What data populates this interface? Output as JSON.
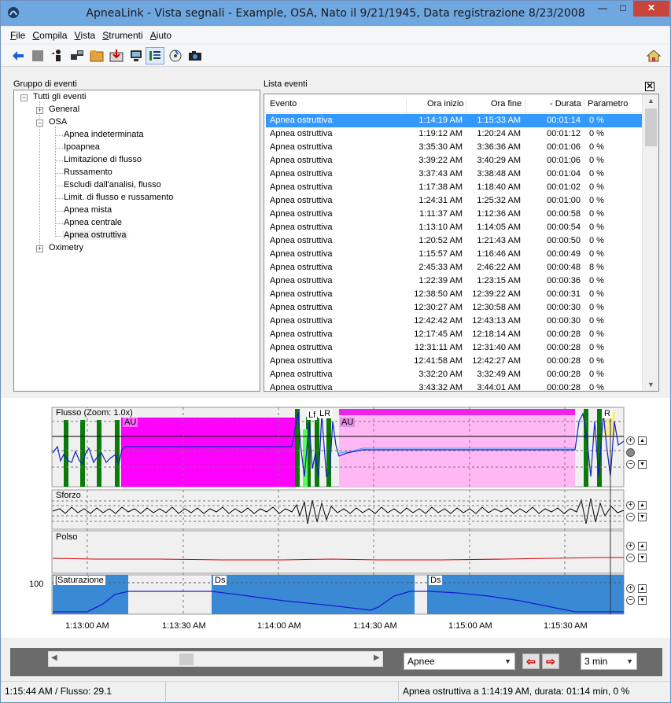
{
  "window": {
    "title": "ApneaLink - Vista segnali - Example, OSA, Nato il 9/21/1945, Data registrazione 8/23/2008"
  },
  "menu": [
    {
      "hotkey": "F",
      "rest": "ile"
    },
    {
      "hotkey": "C",
      "rest": "ompila"
    },
    {
      "hotkey": "V",
      "rest": "ista"
    },
    {
      "hotkey": "S",
      "rest": "trumenti"
    },
    {
      "hotkey": "A",
      "rest": "iuto"
    }
  ],
  "toolbar": {
    "icons": [
      "back-arrow-icon",
      "stop-icon",
      "person-icon",
      "computer-transfer-icon",
      "folder-icon",
      "import-icon",
      "monitor-icon",
      "signal-view-icon",
      "cd-icon",
      "camera-icon",
      "home-icon"
    ]
  },
  "tree": {
    "title": "Gruppo di eventi",
    "root": "Tutti gli eventi",
    "general": "General",
    "osa": "OSA",
    "osa_children": [
      "Apnea  indeterminata",
      "Ipoapnea",
      "Limitazione di flusso",
      "Russamento",
      "Escludi dall'analisi, flusso",
      "Limit. di flusso e russamento",
      "Apnea mista",
      "Apnea centrale",
      "Apnea ostruttiva"
    ],
    "oximetry": "Oximetry"
  },
  "event_list": {
    "title": "Lista eventi",
    "columns": [
      "Evento",
      "Ora inizio",
      "Ora fine",
      "- Durata",
      "Parametro"
    ],
    "rows": [
      [
        "Apnea ostruttiva",
        "1:14:19 AM",
        "1:15:33 AM",
        "00:01:14",
        "0 %"
      ],
      [
        "Apnea ostruttiva",
        "1:19:12 AM",
        "1:20:24 AM",
        "00:01:12",
        "0 %"
      ],
      [
        "Apnea ostruttiva",
        "3:35:30 AM",
        "3:36:36 AM",
        "00:01:06",
        "0 %"
      ],
      [
        "Apnea ostruttiva",
        "3:39:22 AM",
        "3:40:29 AM",
        "00:01:06",
        "0 %"
      ],
      [
        "Apnea ostruttiva",
        "3:37:43 AM",
        "3:38:48 AM",
        "00:01:04",
        "0 %"
      ],
      [
        "Apnea ostruttiva",
        "1:17:38 AM",
        "1:18:40 AM",
        "00:01:02",
        "0 %"
      ],
      [
        "Apnea ostruttiva",
        "1:24:31 AM",
        "1:25:32 AM",
        "00:01:00",
        "0 %"
      ],
      [
        "Apnea ostruttiva",
        "1:11:37 AM",
        "1:12:36 AM",
        "00:00:58",
        "0 %"
      ],
      [
        "Apnea ostruttiva",
        "1:13:10 AM",
        "1:14:05 AM",
        "00:00:54",
        "0 %"
      ],
      [
        "Apnea ostruttiva",
        "1:20:52 AM",
        "1:21:43 AM",
        "00:00:50",
        "0 %"
      ],
      [
        "Apnea ostruttiva",
        "1:15:57 AM",
        "1:16:46 AM",
        "00:00:49",
        "0 %"
      ],
      [
        "Apnea ostruttiva",
        "2:45:33 AM",
        "2:46:22 AM",
        "00:00:48",
        "8 %"
      ],
      [
        "Apnea ostruttiva",
        "1:22:39 AM",
        "1:23:15 AM",
        "00:00:36",
        "0 %"
      ],
      [
        "Apnea ostruttiva",
        "12:38:50 AM",
        "12:39:22 AM",
        "00:00:31",
        "0 %"
      ],
      [
        "Apnea ostruttiva",
        "12:30:27 AM",
        "12:30:58 AM",
        "00:00:30",
        "0 %"
      ],
      [
        "Apnea ostruttiva",
        "12:42:42 AM",
        "12:43:13 AM",
        "00:00:30",
        "0 %"
      ],
      [
        "Apnea ostruttiva",
        "12:17:45 AM",
        "12:18:14 AM",
        "00:00:28",
        "0 %"
      ],
      [
        "Apnea ostruttiva",
        "12:31:11 AM",
        "12:31:40 AM",
        "00:00:28",
        "0 %"
      ],
      [
        "Apnea ostruttiva",
        "12:41:58 AM",
        "12:42:27 AM",
        "00:00:28",
        "0 %"
      ],
      [
        "Apnea ostruttiva",
        "3:32:20 AM",
        "3:32:49 AM",
        "00:00:28",
        "0 %"
      ],
      [
        "Apnea ostruttiva",
        "3:43:32 AM",
        "3:44:01 AM",
        "00:00:28",
        "0 %"
      ]
    ],
    "selected_index": 0
  },
  "signals": {
    "flow_label": "Flusso (Zoom: 1.0x)",
    "effort_label": "Sforzo",
    "pulse_label": "Polso",
    "saturation_label": "[Saturazione",
    "saturation_value_label": "100",
    "markers": {
      "au1": "AU",
      "au2": "AU",
      "lf": "Lf",
      "lr1": "LR",
      "lr2": "R",
      "ds1": "Ds",
      "ds2": "Ds"
    },
    "time_ticks": [
      "1:13:00 AM",
      "1:13:30 AM",
      "1:14:00 AM",
      "1:14:30 AM",
      "1:15:00 AM",
      "1:15:30 AM"
    ]
  },
  "controls": {
    "event_type": "Apnee",
    "window_length": "3 min"
  },
  "status": {
    "left": "1:15:44 AM / Flusso: 29.1",
    "right": "Apnea ostruttiva a 1:14:19 AM, durata: 01:14 min, 0 %"
  },
  "colors": {
    "selection": "#3399ff",
    "apnea_magenta": "#ff00ff",
    "apnea_light": "#ffb8f4",
    "flow_green": "#008000",
    "saturation_blue": "#3a89d4",
    "titlebar": "#6fa7e0"
  }
}
